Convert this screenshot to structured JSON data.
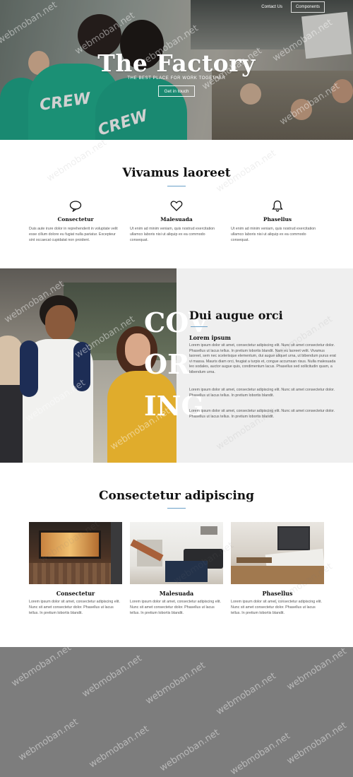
{
  "nav": {
    "contact_label": "Contact Us",
    "components_label": "Components"
  },
  "hero": {
    "title": "The Factory",
    "subtitle": "THE BEST PLACE FOR WORK TOGETHER",
    "cta_label": "Get in touch",
    "shirt_text_1": "CREW",
    "shirt_text_2": "CREW"
  },
  "features": {
    "title": "Vivamus laoreet",
    "items": [
      {
        "icon": "chat-bubble-icon",
        "title": "Consectetur",
        "text": "Duis aute irure dolor in reprehenderit in voluptate velit esse cillum dolore eu fugiat nulla pariatur. Excepteur sint occaecat cupidatat non proident."
      },
      {
        "icon": "heart-icon",
        "title": "Malesuada",
        "text": "Ut enim ad minim veniam, quis nostrud exercitation ullamco laboris nisi ut aliquip ex ea commodo consequat."
      },
      {
        "icon": "bell-icon",
        "title": "Phasellus",
        "text": "Ut enim ad minim veniam, quis nostrud exercitation ullamco laboris nisi ut aliquip ex ea commodo consequat."
      }
    ]
  },
  "split": {
    "big_text": [
      "COV",
      "OR",
      "ING"
    ],
    "title": "Dui augue orci",
    "subtitle": "Lorem ipsum",
    "paragraphs": [
      "Lorem ipsum dolor sit amet, consectetur adipiscing elit. Nunc sit amet consectetur dolor. Phasellus ut lacus tellus. In pretium lobortis blandit. Nam eu laoreet velit. Vivamus laoreet, sem nec scelerisque elementum, dui augue aliquet urna, ut bibendum purus erat vi massa. Mauris diam orci, feugiat a turpis et, congue accumsan risus. Nulla malesuada leo sodales, auctor augue quis, condimentum lacus. Phasellus sed sollicitudin quam, a bibendum urna.",
      "Lorem ipsum dolor sit amet, consectetur adipiscing elit. Nunc sit amet consectetur dolor. Phasellus ut lacus tellus. In pretium lobortis blandit.",
      "Lorem ipsum dolor sit amet, consectetur adipiscing elit. Nunc sit amet consectetur dolor. Phasellus ut lacus tellus. In pretium lobortis blandit."
    ]
  },
  "cards": {
    "title": "Consectetur adipiscing",
    "items": [
      {
        "title": "Consectetur",
        "text": "Lorem ipsum dolor sit amet, consectetur adipiscing elit. Nunc sit amet consectetur dolor. Phasellus ut lacus tellus. In pretium lobortis blandit."
      },
      {
        "title": "Malesuada",
        "text": "Lorem ipsum dolor sit amet, consectetur adipiscing elit. Nunc sit amet consectetur dolor. Phasellus ut lacus tellus. In pretium lobortis blandit."
      },
      {
        "title": "Phasellus",
        "text": "Lorem ipsum dolor sit amet, consectetur adipiscing elit. Nunc sit amet consectetur dolor. Phasellus ut lacus tellus. In pretium lobortis blandit."
      }
    ]
  },
  "watermark": "webmoban.net",
  "colors": {
    "accent_line": "#6aa0c8",
    "footer_bg": "#7d7d7d",
    "split_panel_bg": "#efefef",
    "crew_shirt": "#1fa88a"
  }
}
